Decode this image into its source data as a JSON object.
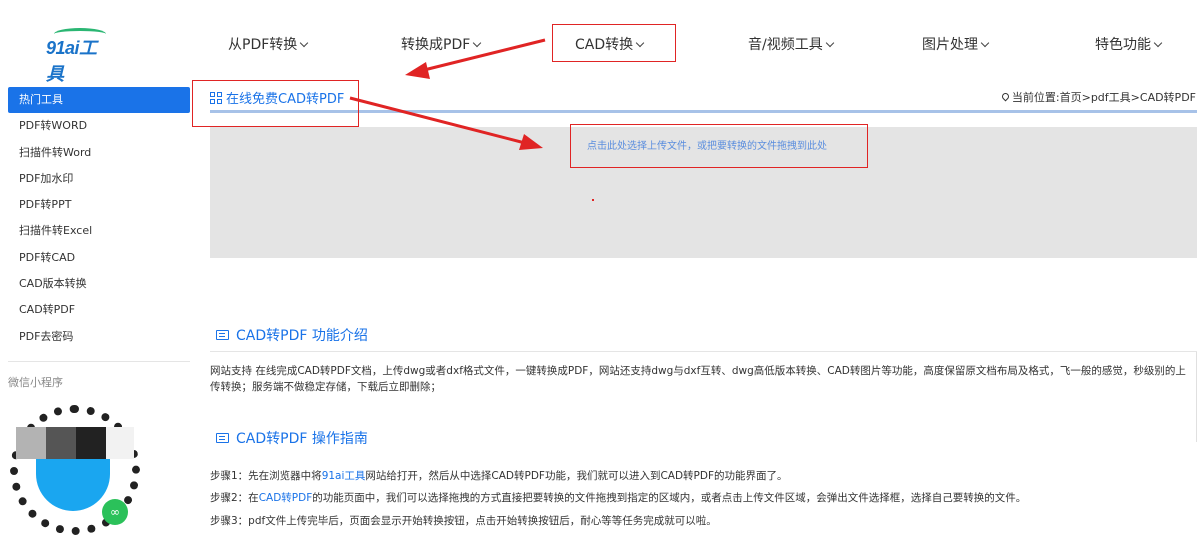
{
  "logo": {
    "text": "91ai工具"
  },
  "nav": {
    "items": [
      {
        "label": "从PDF转换"
      },
      {
        "label": "转换成PDF"
      },
      {
        "label": "CAD转换"
      },
      {
        "label": "音/视频工具"
      },
      {
        "label": "图片处理"
      },
      {
        "label": "特色功能"
      }
    ]
  },
  "sidebar": {
    "items": [
      {
        "label": "热门工具",
        "active": true
      },
      {
        "label": "PDF转WORD"
      },
      {
        "label": "扫描件转Word"
      },
      {
        "label": "PDF加水印"
      },
      {
        "label": "PDF转PPT"
      },
      {
        "label": "扫描件转Excel"
      },
      {
        "label": "PDF转CAD"
      },
      {
        "label": "CAD版本转换"
      },
      {
        "label": "CAD转PDF"
      },
      {
        "label": "PDF去密码"
      }
    ],
    "mini_program_label": "微信小程序"
  },
  "main": {
    "title": "在线免费CAD转PDF",
    "location": "当前位置:首页>pdf工具>CAD转PDF",
    "upload_hint": "点击此处选择上传文件，或把要转换的文件拖拽到此处",
    "intro_title": "CAD转PDF 功能介绍",
    "intro_text": "网站支持 在线完成CAD转PDF文档，上传dwg或者dxf格式文件，一键转换成PDF，网站还支持dwg与dxf互转、dwg高低版本转换、CAD转图片等功能，高度保留原文档布局及格式，飞一般的感觉，秒级别的上传转换；服务端不做稳定存储，下载后立即删除；",
    "guide_title": "CAD转PDF 操作指南",
    "steps": [
      {
        "pre": "步骤1：先在浏览器中将",
        "link": "91ai工具",
        "post": "网站给打开，然后从中选择CAD转PDF功能，我们就可以进入到CAD转PDF的功能界面了。"
      },
      {
        "pre": "步骤2：在",
        "link": "CAD转PDF",
        "post": "的功能页面中，我们可以选择拖拽的方式直接把要转换的文件拖拽到指定的区域内，或者点击上传文件区域，会弹出文件选择框，选择自己要转换的文件。"
      },
      {
        "pre": "步骤3：pdf文件上传完毕后，页面会显示开始转换按钮，点击开始转换按钮后，耐心等等任务完成就可以啦。",
        "link": "",
        "post": ""
      }
    ]
  },
  "colors": {
    "accent": "#1a73e8",
    "annotation": "#e02424",
    "upload_bg": "#e4e4e4"
  }
}
